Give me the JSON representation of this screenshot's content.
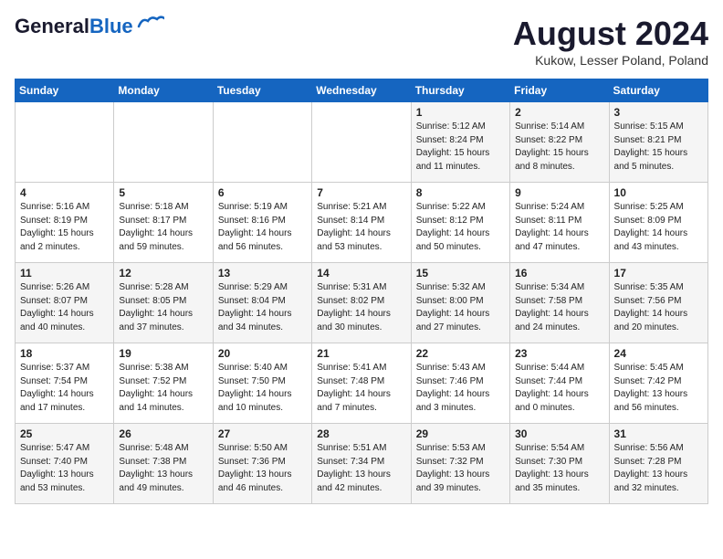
{
  "header": {
    "logo_general": "General",
    "logo_blue": "Blue",
    "month": "August 2024",
    "location": "Kukow, Lesser Poland, Poland"
  },
  "days_of_week": [
    "Sunday",
    "Monday",
    "Tuesday",
    "Wednesday",
    "Thursday",
    "Friday",
    "Saturday"
  ],
  "weeks": [
    [
      {
        "day": "",
        "info": ""
      },
      {
        "day": "",
        "info": ""
      },
      {
        "day": "",
        "info": ""
      },
      {
        "day": "",
        "info": ""
      },
      {
        "day": "1",
        "info": "Sunrise: 5:12 AM\nSunset: 8:24 PM\nDaylight: 15 hours\nand 11 minutes."
      },
      {
        "day": "2",
        "info": "Sunrise: 5:14 AM\nSunset: 8:22 PM\nDaylight: 15 hours\nand 8 minutes."
      },
      {
        "day": "3",
        "info": "Sunrise: 5:15 AM\nSunset: 8:21 PM\nDaylight: 15 hours\nand 5 minutes."
      }
    ],
    [
      {
        "day": "4",
        "info": "Sunrise: 5:16 AM\nSunset: 8:19 PM\nDaylight: 15 hours\nand 2 minutes."
      },
      {
        "day": "5",
        "info": "Sunrise: 5:18 AM\nSunset: 8:17 PM\nDaylight: 14 hours\nand 59 minutes."
      },
      {
        "day": "6",
        "info": "Sunrise: 5:19 AM\nSunset: 8:16 PM\nDaylight: 14 hours\nand 56 minutes."
      },
      {
        "day": "7",
        "info": "Sunrise: 5:21 AM\nSunset: 8:14 PM\nDaylight: 14 hours\nand 53 minutes."
      },
      {
        "day": "8",
        "info": "Sunrise: 5:22 AM\nSunset: 8:12 PM\nDaylight: 14 hours\nand 50 minutes."
      },
      {
        "day": "9",
        "info": "Sunrise: 5:24 AM\nSunset: 8:11 PM\nDaylight: 14 hours\nand 47 minutes."
      },
      {
        "day": "10",
        "info": "Sunrise: 5:25 AM\nSunset: 8:09 PM\nDaylight: 14 hours\nand 43 minutes."
      }
    ],
    [
      {
        "day": "11",
        "info": "Sunrise: 5:26 AM\nSunset: 8:07 PM\nDaylight: 14 hours\nand 40 minutes."
      },
      {
        "day": "12",
        "info": "Sunrise: 5:28 AM\nSunset: 8:05 PM\nDaylight: 14 hours\nand 37 minutes."
      },
      {
        "day": "13",
        "info": "Sunrise: 5:29 AM\nSunset: 8:04 PM\nDaylight: 14 hours\nand 34 minutes."
      },
      {
        "day": "14",
        "info": "Sunrise: 5:31 AM\nSunset: 8:02 PM\nDaylight: 14 hours\nand 30 minutes."
      },
      {
        "day": "15",
        "info": "Sunrise: 5:32 AM\nSunset: 8:00 PM\nDaylight: 14 hours\nand 27 minutes."
      },
      {
        "day": "16",
        "info": "Sunrise: 5:34 AM\nSunset: 7:58 PM\nDaylight: 14 hours\nand 24 minutes."
      },
      {
        "day": "17",
        "info": "Sunrise: 5:35 AM\nSunset: 7:56 PM\nDaylight: 14 hours\nand 20 minutes."
      }
    ],
    [
      {
        "day": "18",
        "info": "Sunrise: 5:37 AM\nSunset: 7:54 PM\nDaylight: 14 hours\nand 17 minutes."
      },
      {
        "day": "19",
        "info": "Sunrise: 5:38 AM\nSunset: 7:52 PM\nDaylight: 14 hours\nand 14 minutes."
      },
      {
        "day": "20",
        "info": "Sunrise: 5:40 AM\nSunset: 7:50 PM\nDaylight: 14 hours\nand 10 minutes."
      },
      {
        "day": "21",
        "info": "Sunrise: 5:41 AM\nSunset: 7:48 PM\nDaylight: 14 hours\nand 7 minutes."
      },
      {
        "day": "22",
        "info": "Sunrise: 5:43 AM\nSunset: 7:46 PM\nDaylight: 14 hours\nand 3 minutes."
      },
      {
        "day": "23",
        "info": "Sunrise: 5:44 AM\nSunset: 7:44 PM\nDaylight: 14 hours\nand 0 minutes."
      },
      {
        "day": "24",
        "info": "Sunrise: 5:45 AM\nSunset: 7:42 PM\nDaylight: 13 hours\nand 56 minutes."
      }
    ],
    [
      {
        "day": "25",
        "info": "Sunrise: 5:47 AM\nSunset: 7:40 PM\nDaylight: 13 hours\nand 53 minutes."
      },
      {
        "day": "26",
        "info": "Sunrise: 5:48 AM\nSunset: 7:38 PM\nDaylight: 13 hours\nand 49 minutes."
      },
      {
        "day": "27",
        "info": "Sunrise: 5:50 AM\nSunset: 7:36 PM\nDaylight: 13 hours\nand 46 minutes."
      },
      {
        "day": "28",
        "info": "Sunrise: 5:51 AM\nSunset: 7:34 PM\nDaylight: 13 hours\nand 42 minutes."
      },
      {
        "day": "29",
        "info": "Sunrise: 5:53 AM\nSunset: 7:32 PM\nDaylight: 13 hours\nand 39 minutes."
      },
      {
        "day": "30",
        "info": "Sunrise: 5:54 AM\nSunset: 7:30 PM\nDaylight: 13 hours\nand 35 minutes."
      },
      {
        "day": "31",
        "info": "Sunrise: 5:56 AM\nSunset: 7:28 PM\nDaylight: 13 hours\nand 32 minutes."
      }
    ]
  ]
}
